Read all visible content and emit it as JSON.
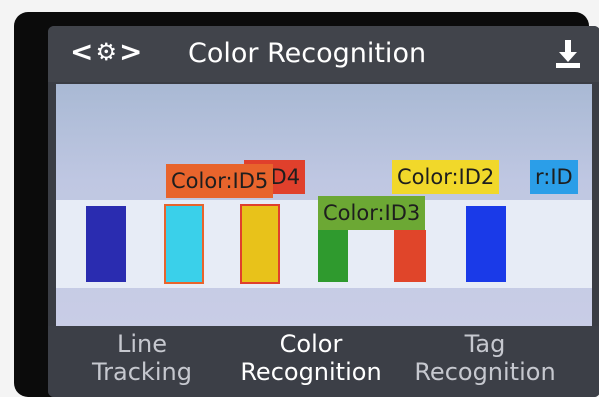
{
  "header": {
    "prev_label": "<",
    "next_label": ">",
    "settings_icon": "gear-icon",
    "title": "Color Recognition",
    "download_icon": "download-icon"
  },
  "tags": [
    {
      "text": "Color:ID5",
      "color": "#e8642c"
    },
    {
      "text": "r:ID4",
      "color": "#e0402c"
    },
    {
      "text": "Color:ID3",
      "color": "#6ca834"
    },
    {
      "text": "Color:ID2",
      "color": "#f1d82a"
    },
    {
      "text": "r:ID",
      "color": "#2b9ee8"
    }
  ],
  "bottom_tabs": [
    {
      "line1": "Line",
      "line2": "Tracking"
    },
    {
      "line1": "Color",
      "line2": "Recognition"
    },
    {
      "line1": "Tag",
      "line2": "Recognition"
    }
  ],
  "colors": {
    "accent": "#ffffff",
    "swatch_dark_blue": "#2a2cb0",
    "swatch_cyan": "#3ad0ea",
    "swatch_yellow": "#e8c21a",
    "swatch_green": "#2f9a2e",
    "swatch_red": "#e0452a",
    "swatch_blue": "#1a3ae8"
  }
}
